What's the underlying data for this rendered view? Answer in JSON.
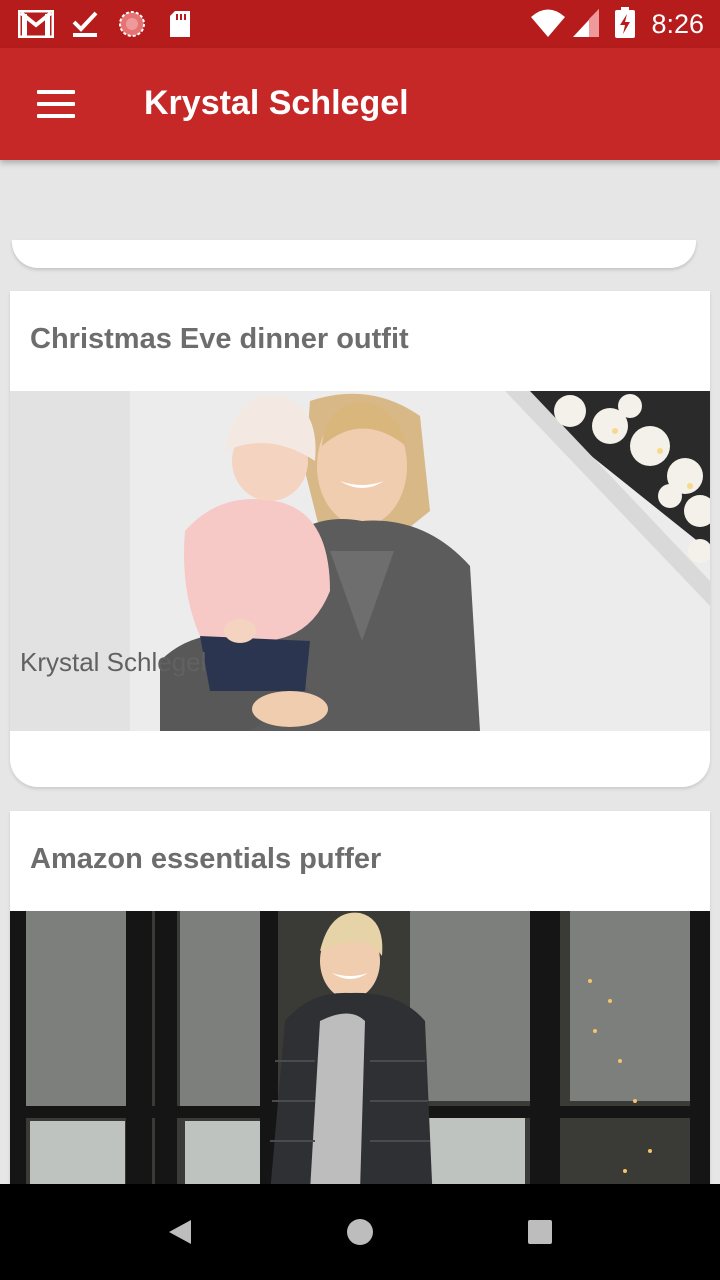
{
  "status_bar": {
    "time": "8:26",
    "icons": [
      "gmail-icon",
      "check-icon",
      "sync-icon",
      "sd-card-icon",
      "wifi-icon",
      "signal-icon",
      "battery-charging-icon"
    ]
  },
  "app_bar": {
    "title": "Krystal Schlegel",
    "menu_icon": "hamburger-menu-icon"
  },
  "feed": {
    "posts": [
      {
        "title": "Christmas Eve dinner outfit",
        "author": "Krystal Schlegel",
        "image": "woman-holding-baby-photo"
      },
      {
        "title": "Amazon essentials puffer",
        "image": "woman-in-puffer-jacket-photo"
      }
    ]
  },
  "nav_bar": {
    "buttons": [
      "back-icon",
      "home-icon",
      "recents-icon"
    ]
  },
  "colors": {
    "status_bar": "#b71c1c",
    "app_bar": "#c62828",
    "background": "#e6e6e6",
    "card_title": "#6d6d6d"
  }
}
